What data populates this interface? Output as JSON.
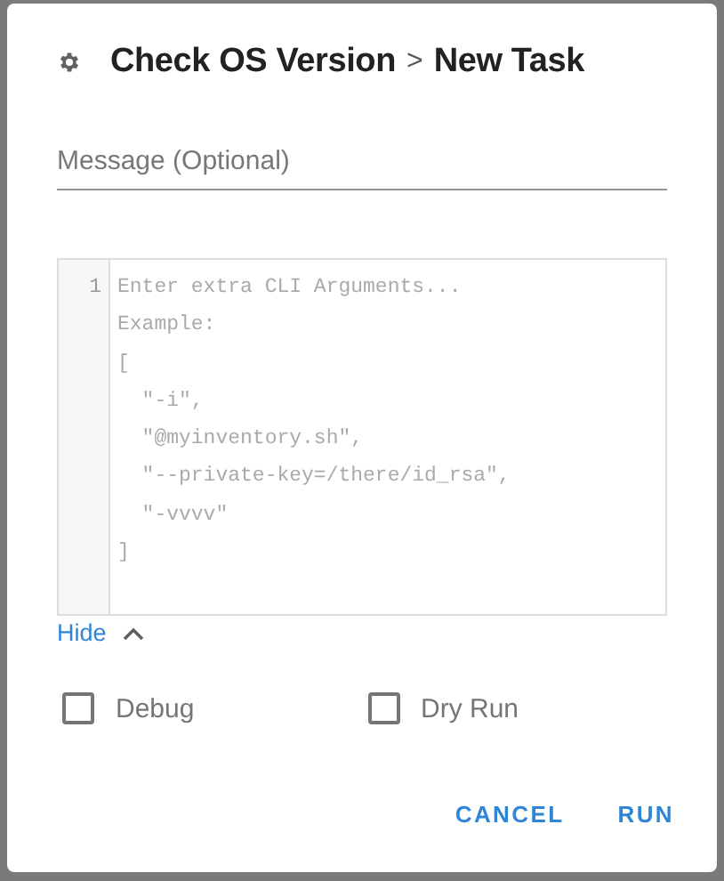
{
  "dialog": {
    "title": "Check OS Version",
    "separator": ">",
    "subtitle": "New Task"
  },
  "message": {
    "placeholder": "Message (Optional)"
  },
  "editor": {
    "line_number": "1",
    "placeholder_lines": [
      "Enter extra CLI Arguments...",
      "Example:",
      "[",
      "  \"-i\",",
      "  \"@myinventory.sh\",",
      "  \"--private-key=/there/id_rsa\",",
      "  \"-vvvv\"",
      "]"
    ]
  },
  "toggle": {
    "label": "Hide",
    "expanded": true
  },
  "options": [
    {
      "label": "Debug",
      "checked": false
    },
    {
      "label": "Dry Run",
      "checked": false
    }
  ],
  "buttons": [
    {
      "label": "CANCEL"
    },
    {
      "label": "RUN"
    }
  ]
}
